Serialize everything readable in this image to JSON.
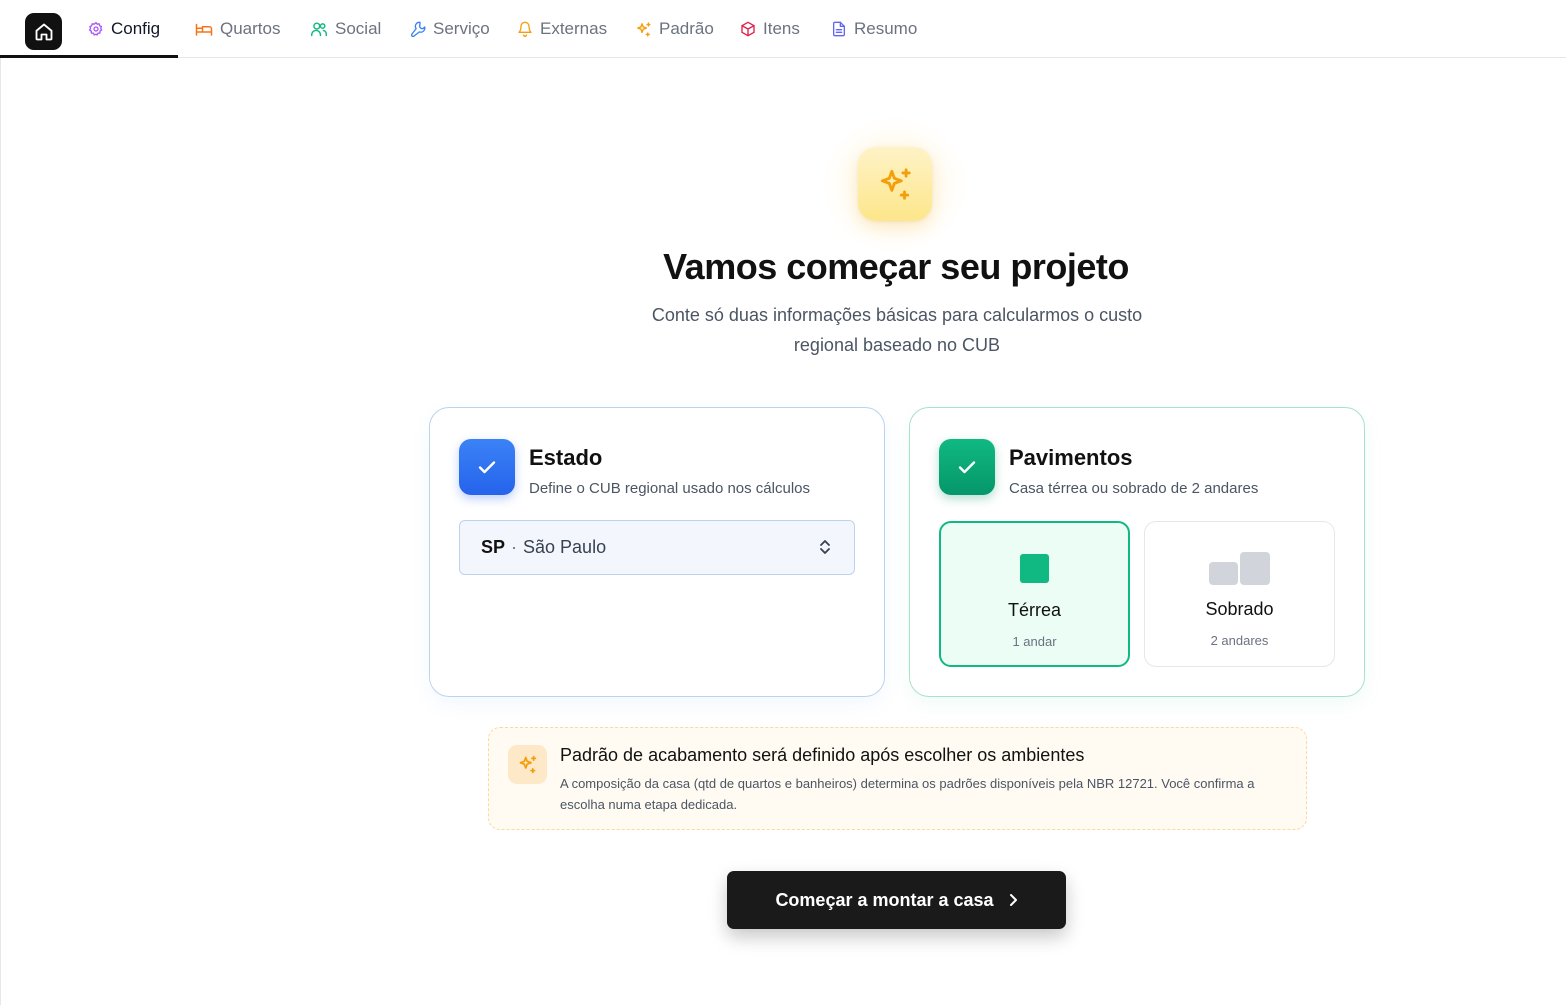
{
  "nav": {
    "home_icon": "home-icon",
    "tabs": [
      {
        "label": "Config",
        "icon": "gear-icon",
        "color": "#a855f7",
        "active": true
      },
      {
        "label": "Quartos",
        "icon": "bed-icon",
        "color": "#f97316"
      },
      {
        "label": "Social",
        "icon": "users-icon",
        "color": "#10b981"
      },
      {
        "label": "Serviço",
        "icon": "wrench-icon",
        "color": "#3b82f6"
      },
      {
        "label": "Externas",
        "icon": "bell-icon",
        "color": "#f59e0b"
      },
      {
        "label": "Padrão",
        "icon": "sparkles-icon",
        "color": "#f59e0b"
      },
      {
        "label": "Itens",
        "icon": "box-icon",
        "color": "#e11d48"
      },
      {
        "label": "Resumo",
        "icon": "document-icon",
        "color": "#6366f1"
      }
    ]
  },
  "hero": {
    "icon": "sparkles-icon",
    "title": "Vamos começar seu projeto",
    "subtitle": "Conte só duas informações básicas para calcularmos o custo regional baseado no CUB"
  },
  "estado": {
    "title": "Estado",
    "description": "Define o CUB regional usado nos cálculos",
    "selected_code": "SP",
    "selected_separator": "·",
    "selected_name": "São Paulo",
    "accent": "#2563eb"
  },
  "pavimentos": {
    "title": "Pavimentos",
    "description": "Casa térrea ou sobrado de 2 andares",
    "accent": "#10b981",
    "options": [
      {
        "label": "Térrea",
        "sub": "1 andar",
        "selected": true
      },
      {
        "label": "Sobrado",
        "sub": "2 andares",
        "selected": false
      }
    ]
  },
  "note": {
    "icon": "sparkles-icon",
    "title": "Padrão de acabamento será definido após escolher os ambientes",
    "text": "A composição da casa (qtd de quartos e banheiros) determina os padrões disponíveis pela NBR 12721. Você confirma a escolha numa etapa dedicada."
  },
  "cta": {
    "label": "Começar a montar a casa",
    "icon": "chevron-right-icon"
  }
}
